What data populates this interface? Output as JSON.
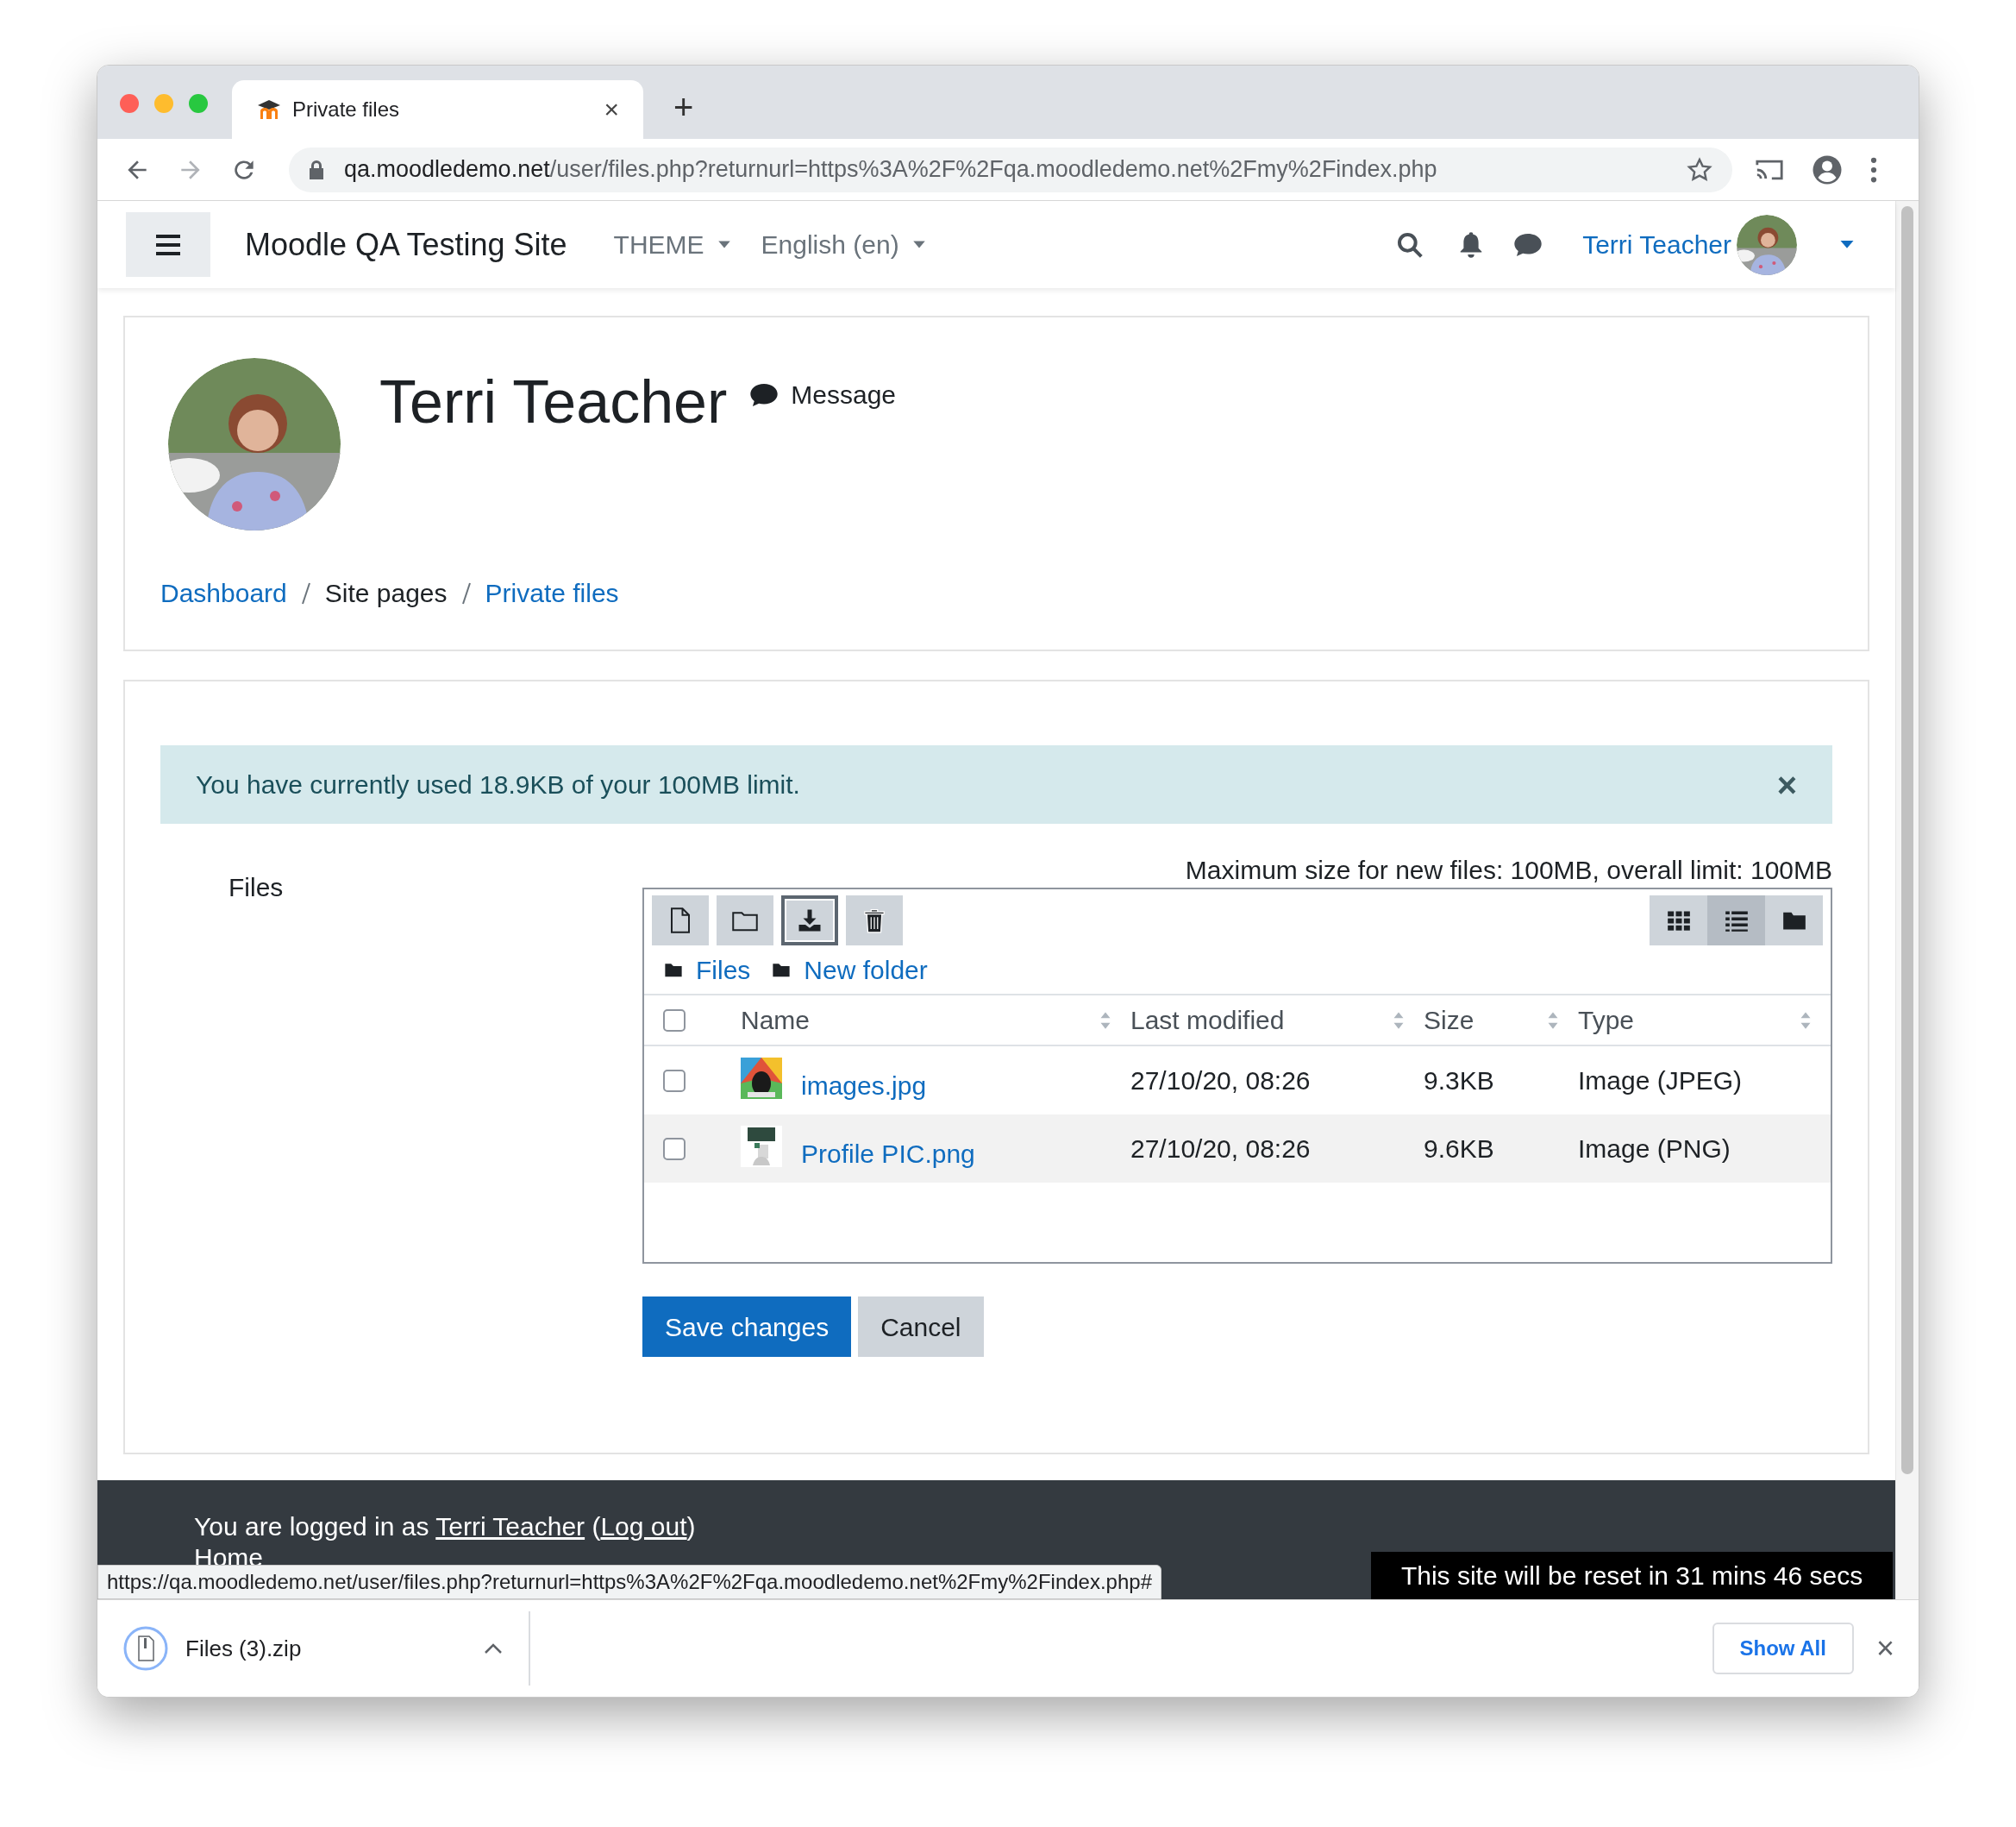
{
  "browser": {
    "tab": {
      "title": "Private files",
      "close": "×"
    },
    "new_tab": "+",
    "url": {
      "host": "qa.moodledemo.net",
      "path": "/user/files.php?returnurl=https%3A%2F%2Fqa.moodledemo.net%2Fmy%2Findex.php"
    }
  },
  "navbar": {
    "site_name": "Moodle QA Testing Site",
    "menus": [
      {
        "label": "THEME"
      },
      {
        "label": "English (en)"
      }
    ],
    "user_name": "Terri Teacher"
  },
  "profile": {
    "name": "Terri Teacher",
    "message": "Message"
  },
  "breadcrumb": [
    {
      "label": "Dashboard",
      "link": true
    },
    {
      "label": "Site pages",
      "link": false
    },
    {
      "label": "Private files",
      "link": true
    }
  ],
  "alert": {
    "text": "You have currently used 18.9KB of your 100MB limit.",
    "close": "×"
  },
  "files_label": "Files",
  "limit_note": "Maximum size for new files: 100MB, overall limit: 100MB",
  "actions": [
    {
      "kind": "add-file",
      "focused": false
    },
    {
      "kind": "new-folder",
      "focused": false
    },
    {
      "kind": "download",
      "focused": true
    },
    {
      "kind": "delete",
      "focused": false
    }
  ],
  "view_modes": [
    {
      "kind": "grid",
      "selected": false
    },
    {
      "kind": "list",
      "selected": true
    },
    {
      "kind": "tree",
      "selected": false
    }
  ],
  "path": [
    {
      "label": "Files"
    },
    {
      "label": "New folder"
    }
  ],
  "table": {
    "select_all": {
      "checked": false
    },
    "columns": [
      "Name",
      "Last modified",
      "Size",
      "Type"
    ],
    "rows": [
      {
        "name": "images.jpg",
        "modified": "27/10/20, 08:26",
        "size": "9.3KB",
        "type": "Image (JPEG)",
        "checked": false,
        "hovered": false
      },
      {
        "name": "Profile PIC.png",
        "modified": "27/10/20, 08:26",
        "size": "9.6KB",
        "type": "Image (PNG)",
        "checked": false,
        "hovered": true
      }
    ]
  },
  "form_buttons": [
    {
      "label": "Save changes",
      "kind": "primary"
    },
    {
      "label": "Cancel",
      "kind": "secondary"
    }
  ],
  "footer": {
    "login": {
      "prefix": "You are logged in as ",
      "user_link": "Terri Teacher",
      "open": " (",
      "logout_link": "Log out",
      "close": ")"
    },
    "home": "Home",
    "reset_notice": "This site will be reset in 31 mins 46 secs"
  },
  "status_url": "https://qa.moodledemo.net/user/files.php?returnurl=https%3A%2F%2Fqa.moodledemo.net%2Fmy%2Findex.php#",
  "downloads": {
    "file": "Files (3).zip",
    "show_all": "Show All",
    "close": "×"
  }
}
